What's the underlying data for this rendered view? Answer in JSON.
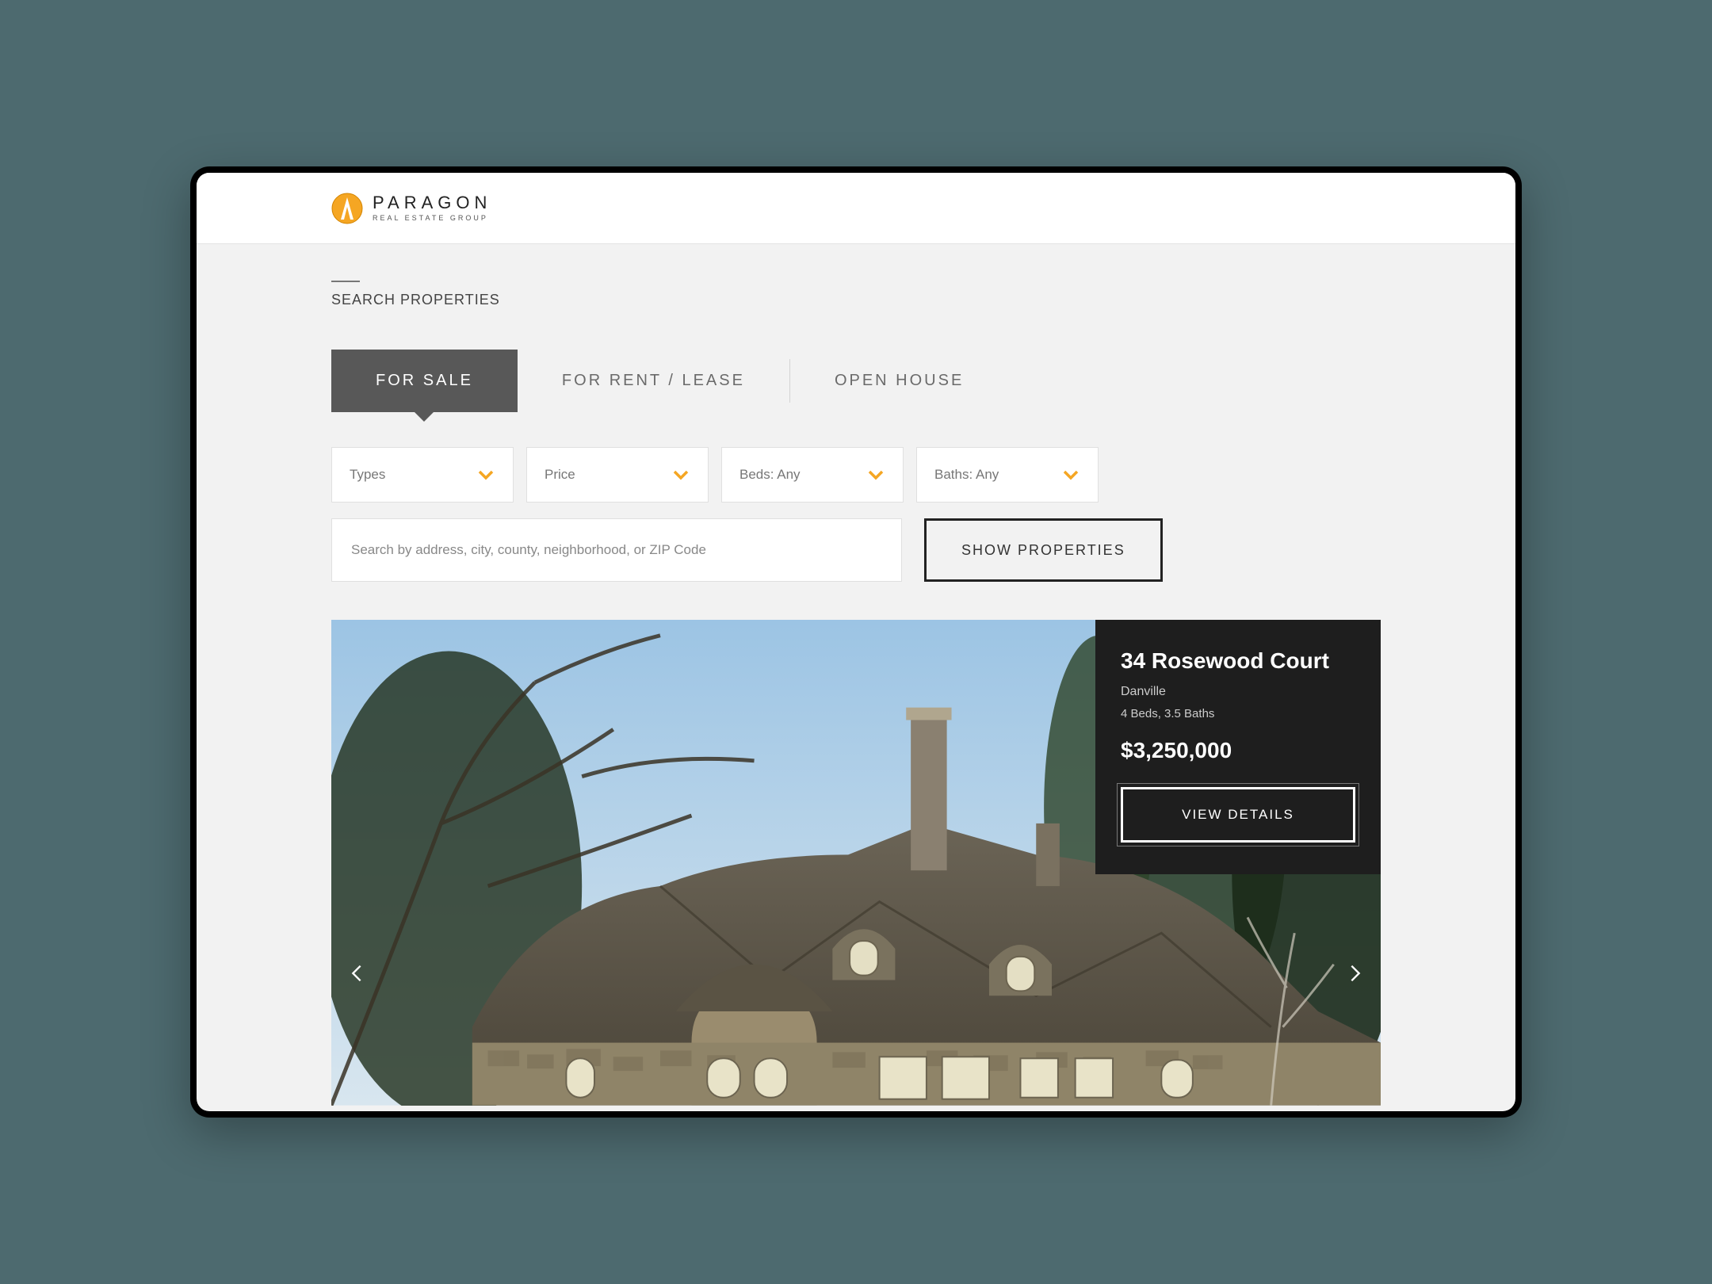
{
  "brand": {
    "name": "PARAGON",
    "tagline": "REAL ESTATE GROUP"
  },
  "section_label": "SEARCH PROPERTIES",
  "tabs": [
    {
      "label": "FOR SALE",
      "active": true
    },
    {
      "label": "FOR RENT / LEASE",
      "active": false
    },
    {
      "label": "OPEN HOUSE",
      "active": false
    }
  ],
  "filters": [
    {
      "label": "Types"
    },
    {
      "label": "Price"
    },
    {
      "label": "Beds: Any"
    },
    {
      "label": "Baths: Any"
    }
  ],
  "search": {
    "placeholder": "Search by address, city, county, neighborhood, or ZIP Code",
    "value": ""
  },
  "show_button": "SHOW PROPERTIES",
  "listing": {
    "address": "34 Rosewood Court",
    "city": "Danville",
    "specs": "4 Beds, 3.5 Baths",
    "price": "$3,250,000",
    "cta": "VIEW DETAILS"
  },
  "colors": {
    "accent": "#f5a623",
    "tab_active_bg": "#585858",
    "page_bg": "#f2f2f2",
    "outer_bg": "#4d6a6f"
  }
}
